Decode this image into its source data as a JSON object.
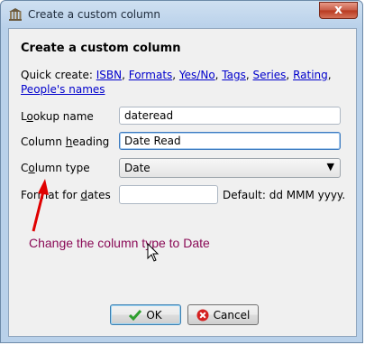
{
  "window": {
    "title": "Create a custom column",
    "close_glyph": "x"
  },
  "dialog": {
    "heading": "Create a custom column",
    "quick_create_label": "Quick create:",
    "quick_links": [
      "ISBN",
      "Formats",
      "Yes/No",
      "Tags",
      "Series",
      "Rating",
      "People's names"
    ]
  },
  "form": {
    "lookup_name": {
      "label_pre": "L",
      "label_ul": "o",
      "label_post": "okup name",
      "value": "dateread"
    },
    "column_heading": {
      "label_pre": "Column ",
      "label_ul": "h",
      "label_post": "eading",
      "value": "Date Read"
    },
    "column_type": {
      "label_pre": "C",
      "label_ul": "o",
      "label_post": "lumn type",
      "value": "Date"
    },
    "format_for_dates": {
      "label_pre": "Format for ",
      "label_ul": "d",
      "label_post": "ates",
      "value": "",
      "default_text": "Default: dd MMM yyyy."
    }
  },
  "annotation": {
    "text": "Change the column type to Date",
    "color": "#8a0a56",
    "arrow_color": "#e00000"
  },
  "buttons": {
    "ok": {
      "label": "OK",
      "icon": "checkmark-icon",
      "icon_color": "#2e9e2e"
    },
    "cancel": {
      "label": "Cancel",
      "icon": "cancel-icon",
      "icon_color": "#d42020"
    }
  }
}
